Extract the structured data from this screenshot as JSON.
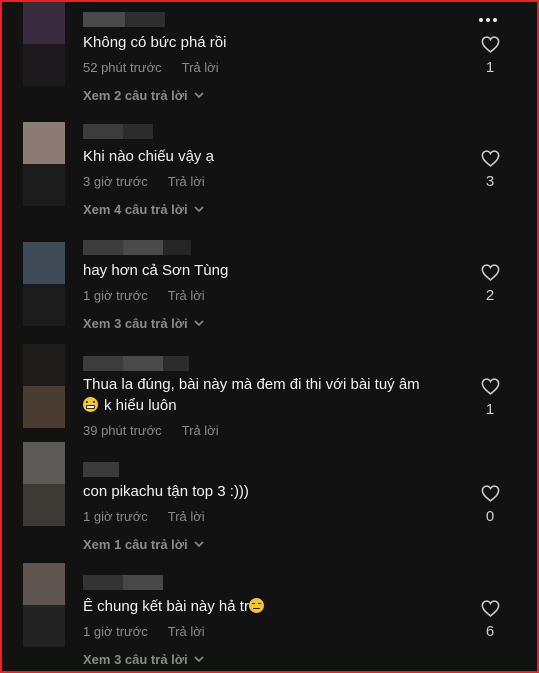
{
  "reply_label": "Trả lời",
  "comments": [
    {
      "text": "Không có bức phá rồi",
      "time": "52 phút trước",
      "likes": "1",
      "view_replies": "Xem 2 câu trả lời",
      "emoji_before": "",
      "text2": ""
    },
    {
      "text": "Khi nào chiếu vậy ạ",
      "time": "3 giờ trước",
      "likes": "3",
      "view_replies": "Xem 4 câu trả lời",
      "emoji_before": "",
      "text2": ""
    },
    {
      "text": "hay hơn cả Sơn Tùng",
      "time": "1 giờ trước",
      "likes": "2",
      "view_replies": "Xem 3 câu trả lời",
      "emoji_before": "",
      "text2": ""
    },
    {
      "text": "Thua la đúng, bài này mà đem đi thi với bài tuý âm",
      "text2": "k hiểu luôn",
      "time": "39 phút trước",
      "likes": "1",
      "view_replies": "",
      "emoji_before": "grimacing-emoji"
    },
    {
      "text": "con pikachu tận top 3 :)))",
      "time": "1 giờ trước",
      "likes": "0",
      "view_replies": "Xem 1 câu trả lời",
      "emoji_before": "",
      "text2": ""
    },
    {
      "text": "Ê chung kết bài này hả tr",
      "time": "1 giờ trước",
      "likes": "6",
      "view_replies": "Xem 3 câu trả lời",
      "emoji_after": "disappointed-face-emoji",
      "text2": ""
    }
  ],
  "colors": {
    "background": "#121212",
    "border": "#e0262b",
    "text": "#f2f2f2",
    "muted": "#8a8a8a"
  }
}
